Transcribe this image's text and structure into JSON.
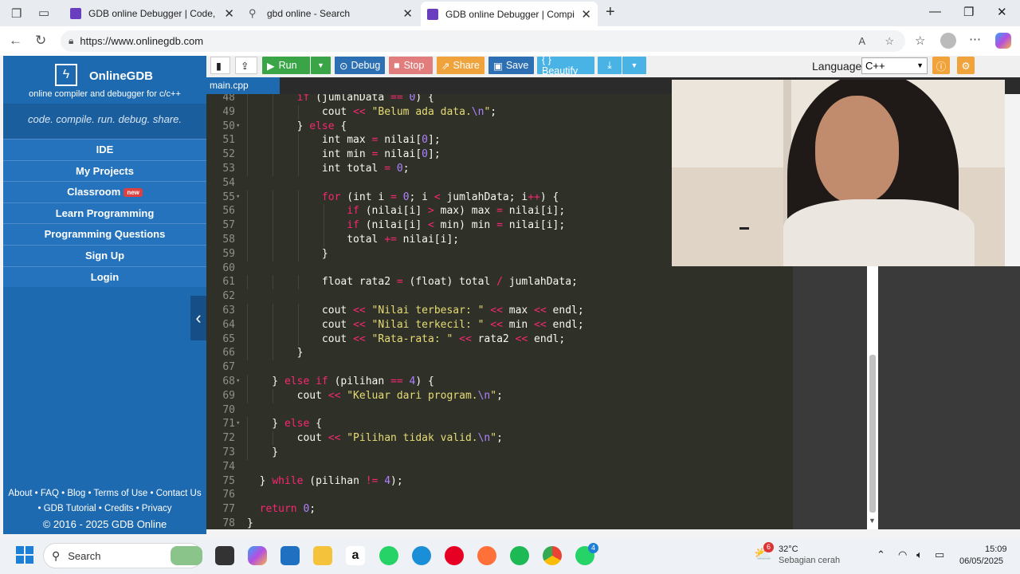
{
  "browser": {
    "tabs": [
      {
        "title": "GDB online Debugger | Code, Co"
      },
      {
        "title": "gbd online - Search"
      },
      {
        "title": "GDB online Debugger | Compiler"
      }
    ],
    "url": "https://www.onlinegdb.com"
  },
  "sidebar": {
    "brand": "OnlineGDB",
    "tagline": "online compiler and debugger for c/c++",
    "slogan": "code. compile. run. debug. share.",
    "items": [
      {
        "label": "IDE"
      },
      {
        "label": "My Projects"
      },
      {
        "label": "Classroom",
        "badge": "new"
      },
      {
        "label": "Learn Programming"
      },
      {
        "label": "Programming Questions"
      },
      {
        "label": "Sign Up"
      },
      {
        "label": "Login"
      }
    ],
    "footer_line1": "About • FAQ • Blog • Terms of Use • Contact Us",
    "footer_line2": "• GDB Tutorial • Credits • Privacy",
    "copyright": "© 2016 - 2025 GDB Online"
  },
  "toolbar": {
    "run": "Run",
    "debug": "Debug",
    "stop": "Stop",
    "share": "Share",
    "save": "Save",
    "beautify": "{ } Beautify",
    "language_label": "Language",
    "language_value": "C++"
  },
  "editor": {
    "file_tab": "main.cpp",
    "lines": [
      {
        "n": "48",
        "fold": "",
        "code": "        if (jumlahData == 0) {"
      },
      {
        "n": "49",
        "fold": "",
        "code": "            cout << \"Belum ada data.\\n\";"
      },
      {
        "n": "50",
        "fold": "▾",
        "code": "        } else {"
      },
      {
        "n": "51",
        "fold": "",
        "code": "            int max = nilai[0];"
      },
      {
        "n": "52",
        "fold": "",
        "code": "            int min = nilai[0];"
      },
      {
        "n": "53",
        "fold": "",
        "code": "            int total = 0;"
      },
      {
        "n": "54",
        "fold": "",
        "code": ""
      },
      {
        "n": "55",
        "fold": "▾",
        "code": "            for (int i = 0; i < jumlahData; i++) {"
      },
      {
        "n": "56",
        "fold": "",
        "code": "                if (nilai[i] > max) max = nilai[i];"
      },
      {
        "n": "57",
        "fold": "",
        "code": "                if (nilai[i] < min) min = nilai[i];"
      },
      {
        "n": "58",
        "fold": "",
        "code": "                total += nilai[i];"
      },
      {
        "n": "59",
        "fold": "",
        "code": "            }"
      },
      {
        "n": "60",
        "fold": "",
        "code": ""
      },
      {
        "n": "61",
        "fold": "",
        "code": "            float rata2 = (float) total / jumlahData;"
      },
      {
        "n": "62",
        "fold": "",
        "code": ""
      },
      {
        "n": "63",
        "fold": "",
        "code": "            cout << \"Nilai terbesar: \" << max << endl;"
      },
      {
        "n": "64",
        "fold": "",
        "code": "            cout << \"Nilai terkecil: \" << min << endl;"
      },
      {
        "n": "65",
        "fold": "",
        "code": "            cout << \"Rata-rata: \" << rata2 << endl;"
      },
      {
        "n": "66",
        "fold": "",
        "code": "        }"
      },
      {
        "n": "67",
        "fold": "",
        "code": ""
      },
      {
        "n": "68",
        "fold": "▾",
        "code": "    } else if (pilihan == 4) {"
      },
      {
        "n": "69",
        "fold": "",
        "code": "        cout << \"Keluar dari program.\\n\";"
      },
      {
        "n": "70",
        "fold": "",
        "code": ""
      },
      {
        "n": "71",
        "fold": "▾",
        "code": "    } else {"
      },
      {
        "n": "72",
        "fold": "",
        "code": "        cout << \"Pilihan tidak valid.\\n\";"
      },
      {
        "n": "73",
        "fold": "",
        "code": "    }"
      },
      {
        "n": "74",
        "fold": "",
        "code": ""
      },
      {
        "n": "75",
        "fold": "",
        "code": "  } while (pilihan != 4);"
      },
      {
        "n": "76",
        "fold": "",
        "code": ""
      },
      {
        "n": "77",
        "fold": "",
        "code": "  return 0;"
      },
      {
        "n": "78",
        "fold": "",
        "code": "}"
      }
    ]
  },
  "taskbar": {
    "search_placeholder": "Search",
    "weather_temp": "32°C",
    "weather_desc": "Sebagian cerah",
    "weather_badge": "6",
    "whatsapp_badge": "4",
    "time": "15:09",
    "date": "06/05/2025"
  }
}
